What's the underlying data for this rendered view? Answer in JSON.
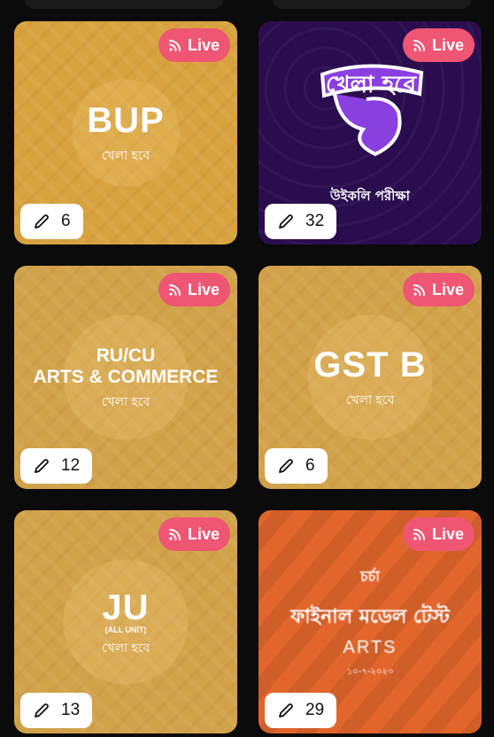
{
  "live_label": "Live",
  "cards": [
    {
      "title": "BUP",
      "subtitle_bn": "খেলা হবে",
      "count": "6"
    },
    {
      "logo_text_bn": "খেলা হবে",
      "subtitle_bn": "উইকলি পরীক্ষা",
      "count": "32"
    },
    {
      "title_line1": "RU/CU",
      "title_line2": "ARTS & COMMERCE",
      "subtitle_bn": "খেলা হবে",
      "count": "12"
    },
    {
      "title": "GST B",
      "subtitle_bn": "খেলা হবে",
      "count": "6"
    },
    {
      "title": "JU",
      "title_note": "(ALL UNIT)",
      "subtitle_bn": "খেলা হবে",
      "count": "13"
    },
    {
      "brand_bn": "চর্চা",
      "title_bn": "ফাইনাল মডেল টেস্ট",
      "subtitle": "ARTS",
      "date_bn": "১০-৭-২০২৩",
      "count": "29"
    }
  ],
  "colors": {
    "live_badge": "#ef5673",
    "card_gold": "#d8a23f",
    "card_purple": "#2a0d4f",
    "card_orange": "#e2662c",
    "page_bg": "#0b0b0b"
  },
  "icons": {
    "live": "rss-feed-icon",
    "count": "pencil-icon"
  }
}
